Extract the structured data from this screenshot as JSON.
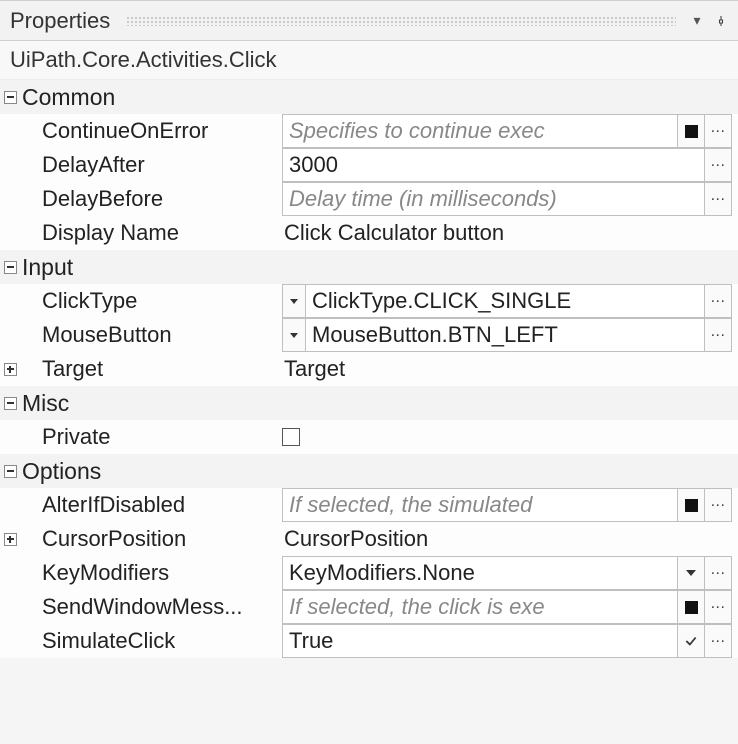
{
  "header": {
    "title": "Properties"
  },
  "activityType": "UiPath.Core.Activities.Click",
  "categories": {
    "common": {
      "label": "Common",
      "props": {
        "continueOnError": {
          "label": "ContinueOnError",
          "placeholder": "Specifies to continue exec"
        },
        "delayAfter": {
          "label": "DelayAfter",
          "value": "3000"
        },
        "delayBefore": {
          "label": "DelayBefore",
          "placeholder": "Delay time (in milliseconds)"
        },
        "displayName": {
          "label": "Display Name",
          "value": "Click Calculator button"
        }
      }
    },
    "input": {
      "label": "Input",
      "props": {
        "clickType": {
          "label": "ClickType",
          "value": "ClickType.CLICK_SINGLE"
        },
        "mouseButton": {
          "label": "MouseButton",
          "value": "MouseButton.BTN_LEFT"
        },
        "target": {
          "label": "Target",
          "value": "Target"
        }
      }
    },
    "misc": {
      "label": "Misc",
      "props": {
        "private": {
          "label": "Private"
        }
      }
    },
    "options": {
      "label": "Options",
      "props": {
        "alterIfDisabled": {
          "label": "AlterIfDisabled",
          "placeholder": "If selected, the simulated"
        },
        "cursorPosition": {
          "label": "CursorPosition",
          "value": "CursorPosition"
        },
        "keyModifiers": {
          "label": "KeyModifiers",
          "value": "KeyModifiers.None"
        },
        "sendWindowMessages": {
          "label": "SendWindowMess...",
          "placeholder": "If selected, the click is exe"
        },
        "simulateClick": {
          "label": "SimulateClick",
          "value": "True"
        }
      }
    }
  }
}
